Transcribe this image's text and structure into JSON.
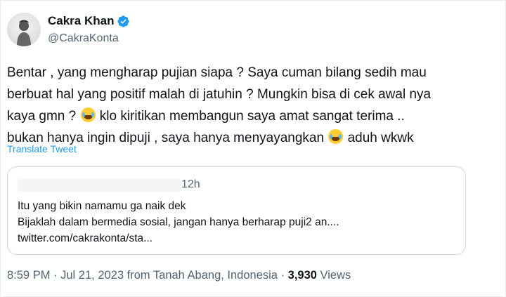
{
  "author": {
    "display_name": "Cakra Khan",
    "handle": "@CakraKonta",
    "verified_icon": "verified-badge-icon",
    "badge_color": "#1d9bf0"
  },
  "tweet": {
    "lines": [
      {
        "before": "Bentar , yang mengharap pujian siapa ? Saya cuman bilang sedih mau",
        "emoji": false,
        "after": ""
      },
      {
        "before": "berbuat hal yang positif malah di jatuhin ? Mungkin bisa di cek awal nya",
        "emoji": false,
        "after": ""
      },
      {
        "before": "kaya gmn ? ",
        "emoji": true,
        "after": " klo kiritikan membangun saya amat sangat terima .."
      },
      {
        "before": "bukan hanya ingin dipuji , saya hanya menyayangkan ",
        "emoji": true,
        "after": " aduh wkwk"
      }
    ],
    "emoji_name": "face-with-tears-of-joy-icon",
    "translate_label": "Translate Tweet"
  },
  "quote": {
    "time": "12h",
    "line1": "Itu yang bikin namamu ga naik dek",
    "line2": "Bijaklah dalam bermedia sosial, jangan hanya berharap puji2 an....",
    "line3": "twitter.com/cakrakonta/sta..."
  },
  "meta": {
    "time": "8:59 PM",
    "sep1": " · ",
    "date": "Jul 21, 2023",
    "from": " from Tanah Abang, Indonesia",
    "sep2": " · ",
    "views_count": "3,930",
    "views_label": " Views"
  },
  "colors": {
    "accent": "#1d9bf0",
    "text": "#0f1419",
    "secondary": "#536471",
    "border": "#cfd9de"
  }
}
